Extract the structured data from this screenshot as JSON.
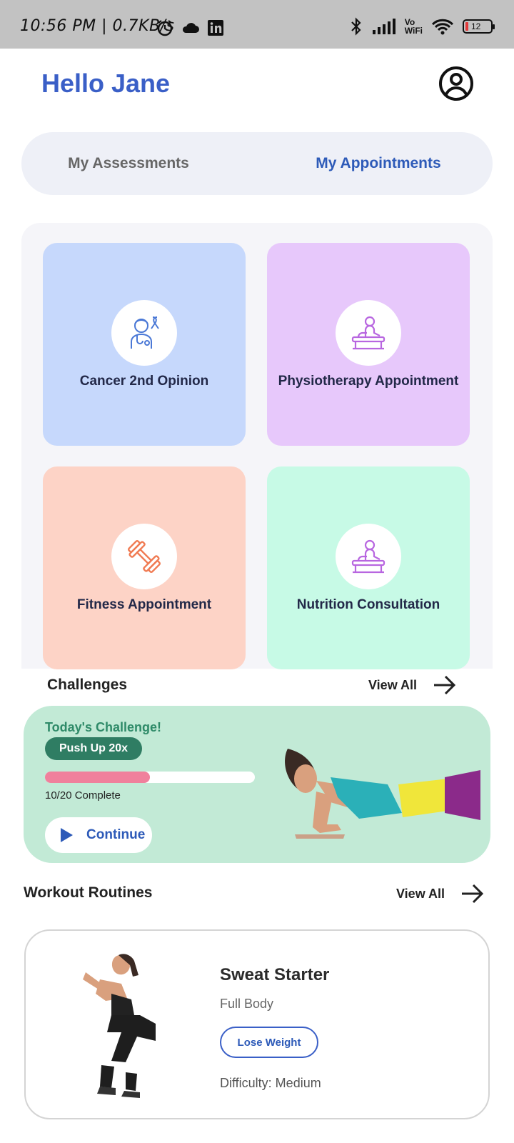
{
  "status_bar": {
    "time": "10:56 PM | 0.7KB/s",
    "battery": "12",
    "vowifi_top": "Vo",
    "vowifi_bottom": "WiFi"
  },
  "header": {
    "greeting": "Hello Jane",
    "avatar_icon": "account-circle-icon"
  },
  "tabs": {
    "items": [
      {
        "label": "My Assessments",
        "selected": false
      },
      {
        "label": "My Appointments",
        "selected": true
      }
    ]
  },
  "appointments": {
    "cards": [
      {
        "label": "Cancer 2nd Opinion",
        "icon": "doctor-ribbon-icon",
        "color": "#c6d8fc"
      },
      {
        "label": "Physiotherapy Appointment",
        "icon": "massage-table-icon",
        "color": "#e7c8fb"
      },
      {
        "label": "Fitness Appointment",
        "icon": "dumbbell-icon",
        "color": "#fdd3c6"
      },
      {
        "label": "Nutrition Consultation",
        "icon": "massage-table-icon",
        "color": "#c7fae6"
      }
    ]
  },
  "challenges": {
    "title": "Challenges",
    "view_all": "View All",
    "card": {
      "heading": "Today's Challenge!",
      "name": "Push Up 20x",
      "progress_done": 10,
      "progress_total": 20,
      "progress_text": "10/20 Complete",
      "button_label": "Continue"
    }
  },
  "workouts": {
    "title": "Workout Routines",
    "view_all": "View All",
    "items": [
      {
        "name": "Sweat Starter",
        "target": "Full Body",
        "tag": "Lose Weight",
        "difficulty": "Difficulty: Medium"
      }
    ]
  },
  "colors": {
    "accent": "#3a5fc7",
    "challenge_bg": "#c2ead6",
    "progress_fill": "#f0809c"
  }
}
